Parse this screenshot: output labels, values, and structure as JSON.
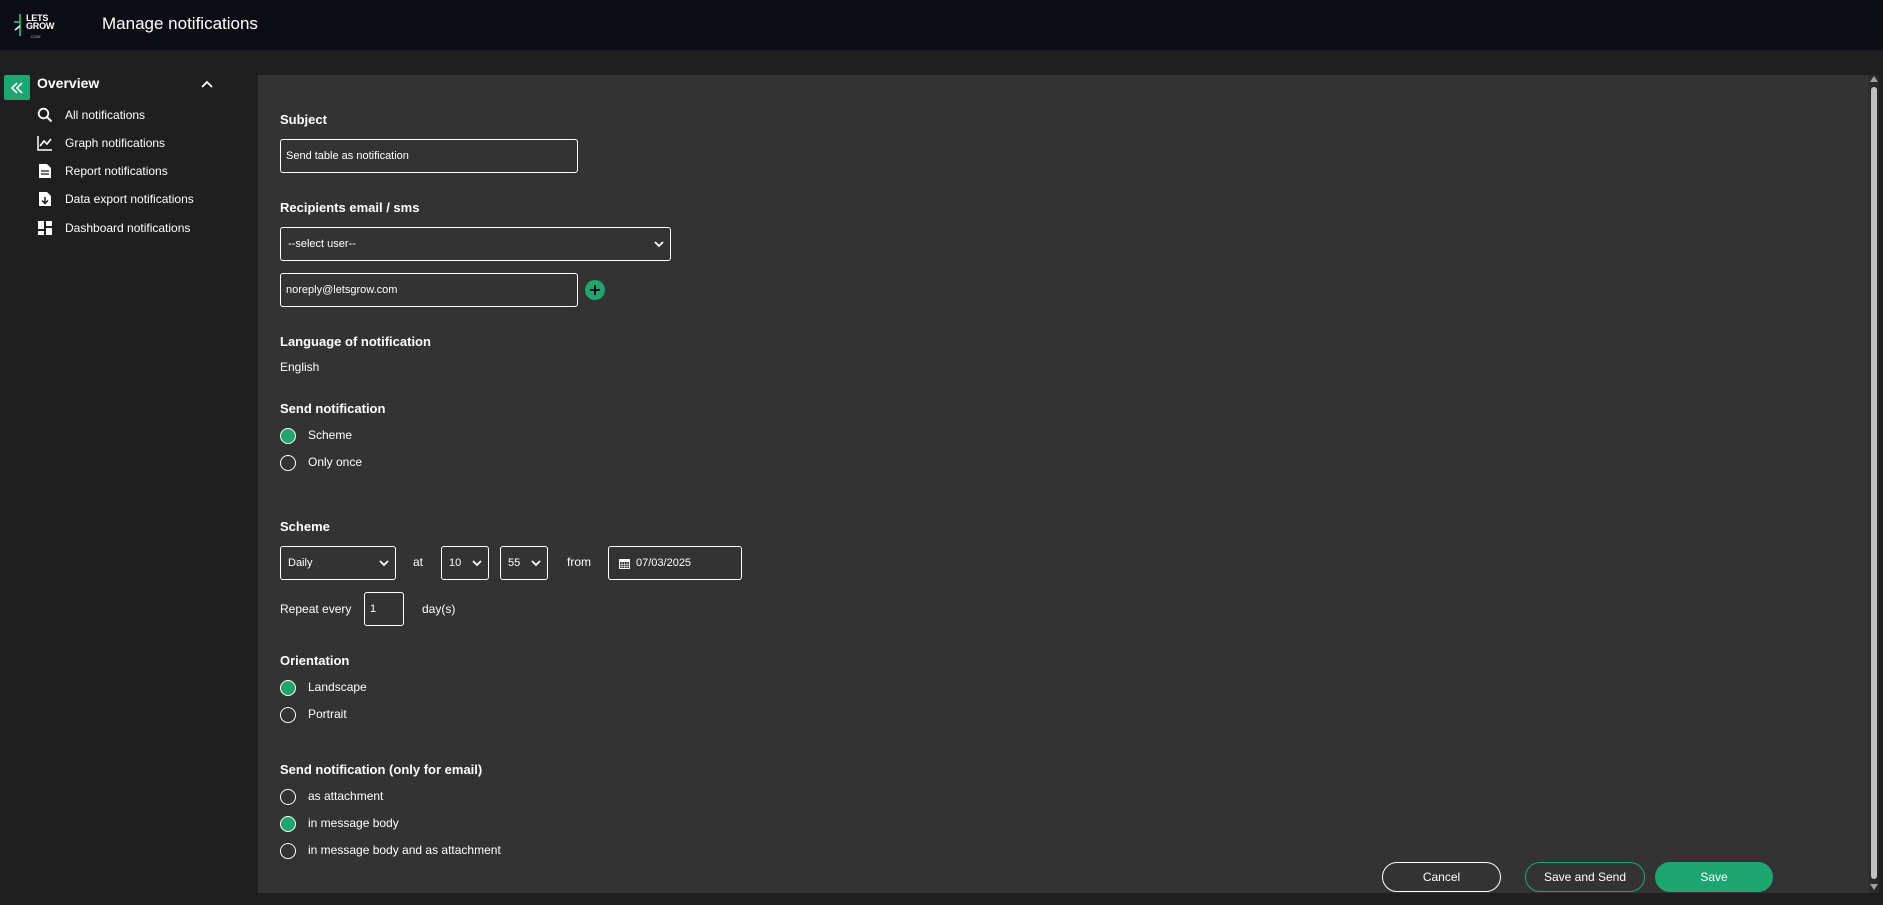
{
  "header": {
    "logo_text": "LETS GROW",
    "logo_sub": ".COM",
    "title": "Manage notifications"
  },
  "sidebar": {
    "section_title": "Overview",
    "items": [
      {
        "label": "All notifications",
        "icon": "search-icon"
      },
      {
        "label": "Graph notifications",
        "icon": "line-chart-icon"
      },
      {
        "label": "Report notifications",
        "icon": "document-icon"
      },
      {
        "label": "Data export notifications",
        "icon": "file-download-icon"
      },
      {
        "label": "Dashboard notifications",
        "icon": "dashboard-icon"
      }
    ]
  },
  "form": {
    "subject_label": "Subject",
    "subject_value": "Send table as notification",
    "recipients_label": "Recipients email / sms",
    "select_user_value": "--select user--",
    "email_value": "noreply@letsgrow.com",
    "language_label": "Language of notification",
    "language_value": "English",
    "send_notification_label": "Send notification",
    "send_options": [
      {
        "label": "Scheme",
        "checked": true
      },
      {
        "label": "Only once",
        "checked": false
      }
    ],
    "scheme_label": "Scheme",
    "scheme_frequency": "Daily",
    "at_label": "at",
    "hour_value": "10",
    "minute_value": "55",
    "from_label": "from",
    "date_value": "07/03/2025",
    "repeat_label": "Repeat every",
    "repeat_value": "1",
    "repeat_unit": "day(s)",
    "orientation_label": "Orientation",
    "orientation_options": [
      {
        "label": "Landscape",
        "checked": true
      },
      {
        "label": "Portrait",
        "checked": false
      }
    ],
    "email_mode_label": "Send notification (only for email)",
    "email_mode_options": [
      {
        "label": "as attachment",
        "checked": false
      },
      {
        "label": "in message body",
        "checked": true
      },
      {
        "label": "in message body and as attachment",
        "checked": false
      }
    ]
  },
  "actions": {
    "cancel_label": "Cancel",
    "save_send_label": "Save and Send",
    "save_label": "Save"
  },
  "colors": {
    "accent": "#1ea672",
    "header_bg": "#0c0c14",
    "panel_bg": "#333333",
    "page_bg": "#1f1f1f"
  }
}
